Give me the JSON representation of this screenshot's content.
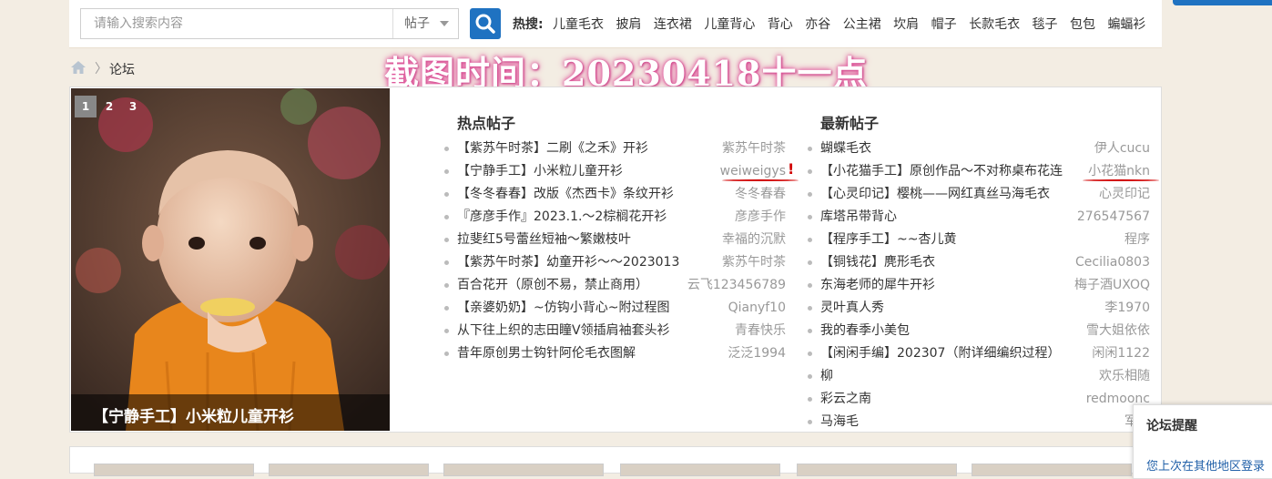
{
  "search": {
    "placeholder": "请输入搜索内容",
    "type_label": "帖子"
  },
  "hot_search": {
    "label": "热搜:",
    "tags": [
      "儿童毛衣",
      "披肩",
      "连衣裙",
      "儿童背心",
      "背心",
      "亦谷",
      "公主裙",
      "坎肩",
      "帽子",
      "长款毛衣",
      "毯子",
      "包包",
      "蝙蝠衫"
    ]
  },
  "breadcrumb": {
    "current": "论坛"
  },
  "watermark": "截图时间：20230418十一点",
  "slider": {
    "tabs": [
      "1",
      "2",
      "3"
    ],
    "caption": "【宁静手工】小米粒儿童开衫"
  },
  "hot_posts": {
    "title": "热点帖子",
    "items": [
      {
        "title": "【紫苏午时茶】二刷《之禾》开衫",
        "author": "紫苏午时茶"
      },
      {
        "title": "【宁静手工】小米粒儿童开衫",
        "author": "weiweigys"
      },
      {
        "title": "【冬冬春春】改版《杰西卡》条纹开衫",
        "author": "冬冬春春"
      },
      {
        "title": "『彦彦手作』2023.1.～2棕榈花开衫",
        "author": "彦彦手作"
      },
      {
        "title": "拉斐红5号蕾丝短袖～繁嫩枝叶",
        "author": "幸福的沉默"
      },
      {
        "title": "【紫苏午时茶】幼童开衫～～2023013",
        "author": "紫苏午时茶"
      },
      {
        "title": "百合花开（原创不易，禁止商用）",
        "author": "云飞123456789"
      },
      {
        "title": "【亲婆奶奶】~仿钩小背心~附过程图",
        "author": "Qianyf10"
      },
      {
        "title": "从下往上织的志田瞳V领插肩袖套头衫",
        "author": "青春快乐"
      },
      {
        "title": "昔年原创男士钩针阿伦毛衣图解",
        "author": "泛泛1994"
      }
    ]
  },
  "new_posts": {
    "title": "最新帖子",
    "items": [
      {
        "title": "蝴蝶毛衣",
        "author": "伊人cucu"
      },
      {
        "title": "【小花猫手工】原创作品～不对称桌布花连",
        "author": "小花猫nkn"
      },
      {
        "title": "【心灵印记】樱桃——网红真丝马海毛衣",
        "author": "心灵印记"
      },
      {
        "title": "库塔吊带背心",
        "author": "276547567"
      },
      {
        "title": "【程序手工】~~杏儿黄",
        "author": "程序"
      },
      {
        "title": "【铜钱花】麂形毛衣",
        "author": "Cecilia0803"
      },
      {
        "title": "东海老师的犀牛开衫",
        "author": "梅子酒UXOQ"
      },
      {
        "title": "灵叶真人秀",
        "author": "李1970"
      },
      {
        "title": "我的春季小美包",
        "author": "雪大姐依依"
      },
      {
        "title": "【闲闲手编】202307（附详细编织过程）",
        "author": "闲闲1122"
      },
      {
        "title": "柳",
        "author": "欢乐相随"
      },
      {
        "title": "彩云之南",
        "author": "redmoonc"
      },
      {
        "title": "马海毛",
        "author": "军曹"
      }
    ]
  },
  "side_widget": {
    "title": "论坛提醒",
    "text": "您上次在其他地区登录"
  },
  "colors": {
    "accent": "#1f72c1",
    "annotation": "#d10000",
    "watermark_glow": "#e0569c"
  },
  "icons": {
    "search": "search-icon",
    "home": "home-icon",
    "caret": "caret-down-icon"
  }
}
